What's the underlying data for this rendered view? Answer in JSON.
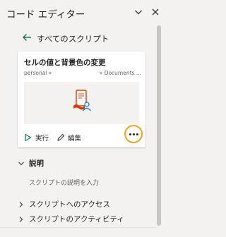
{
  "header": {
    "title": "コード エディター"
  },
  "nav": {
    "back_label": "すべてのスクリプト"
  },
  "script_card": {
    "title": "セルの値と背景色の変更",
    "path_left": "personal »",
    "path_right": "» Documents ...",
    "thumbnail_icon": "script-document-icon",
    "run_label": "実行",
    "edit_label": "編集"
  },
  "sections": {
    "description_label": "説明",
    "description_placeholder": "スクリプトの説明を入力",
    "access_label": "スクリプトへのアクセス",
    "activity_label": "スクリプトのアクティビティ"
  },
  "colors": {
    "accent_green": "#107c41",
    "highlight_orange": "#f7a21b",
    "script_icon_red": "#d83b01"
  }
}
